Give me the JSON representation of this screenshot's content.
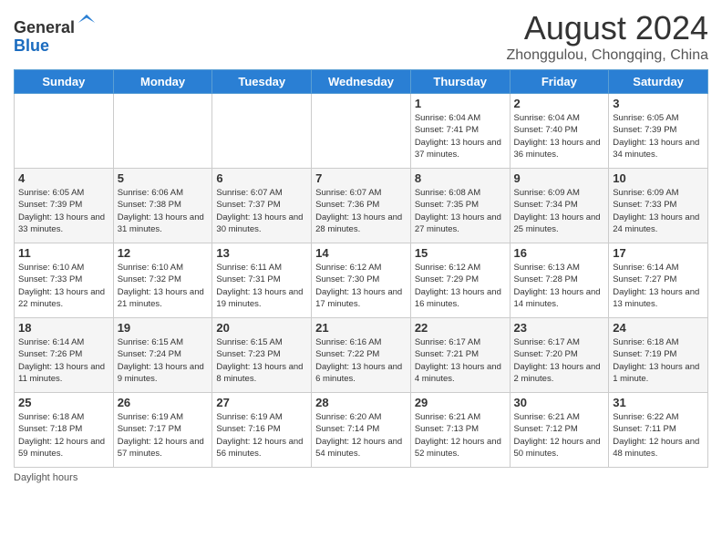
{
  "logo": {
    "general": "General",
    "blue": "Blue"
  },
  "title": "August 2024",
  "location": "Zhonggulou, Chongqing, China",
  "days_header": [
    "Sunday",
    "Monday",
    "Tuesday",
    "Wednesday",
    "Thursday",
    "Friday",
    "Saturday"
  ],
  "weeks": [
    [
      {
        "day": "",
        "info": ""
      },
      {
        "day": "",
        "info": ""
      },
      {
        "day": "",
        "info": ""
      },
      {
        "day": "",
        "info": ""
      },
      {
        "day": "1",
        "info": "Sunrise: 6:04 AM\nSunset: 7:41 PM\nDaylight: 13 hours\nand 37 minutes."
      },
      {
        "day": "2",
        "info": "Sunrise: 6:04 AM\nSunset: 7:40 PM\nDaylight: 13 hours\nand 36 minutes."
      },
      {
        "day": "3",
        "info": "Sunrise: 6:05 AM\nSunset: 7:39 PM\nDaylight: 13 hours\nand 34 minutes."
      }
    ],
    [
      {
        "day": "4",
        "info": "Sunrise: 6:05 AM\nSunset: 7:39 PM\nDaylight: 13 hours\nand 33 minutes."
      },
      {
        "day": "5",
        "info": "Sunrise: 6:06 AM\nSunset: 7:38 PM\nDaylight: 13 hours\nand 31 minutes."
      },
      {
        "day": "6",
        "info": "Sunrise: 6:07 AM\nSunset: 7:37 PM\nDaylight: 13 hours\nand 30 minutes."
      },
      {
        "day": "7",
        "info": "Sunrise: 6:07 AM\nSunset: 7:36 PM\nDaylight: 13 hours\nand 28 minutes."
      },
      {
        "day": "8",
        "info": "Sunrise: 6:08 AM\nSunset: 7:35 PM\nDaylight: 13 hours\nand 27 minutes."
      },
      {
        "day": "9",
        "info": "Sunrise: 6:09 AM\nSunset: 7:34 PM\nDaylight: 13 hours\nand 25 minutes."
      },
      {
        "day": "10",
        "info": "Sunrise: 6:09 AM\nSunset: 7:33 PM\nDaylight: 13 hours\nand 24 minutes."
      }
    ],
    [
      {
        "day": "11",
        "info": "Sunrise: 6:10 AM\nSunset: 7:33 PM\nDaylight: 13 hours\nand 22 minutes."
      },
      {
        "day": "12",
        "info": "Sunrise: 6:10 AM\nSunset: 7:32 PM\nDaylight: 13 hours\nand 21 minutes."
      },
      {
        "day": "13",
        "info": "Sunrise: 6:11 AM\nSunset: 7:31 PM\nDaylight: 13 hours\nand 19 minutes."
      },
      {
        "day": "14",
        "info": "Sunrise: 6:12 AM\nSunset: 7:30 PM\nDaylight: 13 hours\nand 17 minutes."
      },
      {
        "day": "15",
        "info": "Sunrise: 6:12 AM\nSunset: 7:29 PM\nDaylight: 13 hours\nand 16 minutes."
      },
      {
        "day": "16",
        "info": "Sunrise: 6:13 AM\nSunset: 7:28 PM\nDaylight: 13 hours\nand 14 minutes."
      },
      {
        "day": "17",
        "info": "Sunrise: 6:14 AM\nSunset: 7:27 PM\nDaylight: 13 hours\nand 13 minutes."
      }
    ],
    [
      {
        "day": "18",
        "info": "Sunrise: 6:14 AM\nSunset: 7:26 PM\nDaylight: 13 hours\nand 11 minutes."
      },
      {
        "day": "19",
        "info": "Sunrise: 6:15 AM\nSunset: 7:24 PM\nDaylight: 13 hours\nand 9 minutes."
      },
      {
        "day": "20",
        "info": "Sunrise: 6:15 AM\nSunset: 7:23 PM\nDaylight: 13 hours\nand 8 minutes."
      },
      {
        "day": "21",
        "info": "Sunrise: 6:16 AM\nSunset: 7:22 PM\nDaylight: 13 hours\nand 6 minutes."
      },
      {
        "day": "22",
        "info": "Sunrise: 6:17 AM\nSunset: 7:21 PM\nDaylight: 13 hours\nand 4 minutes."
      },
      {
        "day": "23",
        "info": "Sunrise: 6:17 AM\nSunset: 7:20 PM\nDaylight: 13 hours\nand 2 minutes."
      },
      {
        "day": "24",
        "info": "Sunrise: 6:18 AM\nSunset: 7:19 PM\nDaylight: 13 hours\nand 1 minute."
      }
    ],
    [
      {
        "day": "25",
        "info": "Sunrise: 6:18 AM\nSunset: 7:18 PM\nDaylight: 12 hours\nand 59 minutes."
      },
      {
        "day": "26",
        "info": "Sunrise: 6:19 AM\nSunset: 7:17 PM\nDaylight: 12 hours\nand 57 minutes."
      },
      {
        "day": "27",
        "info": "Sunrise: 6:19 AM\nSunset: 7:16 PM\nDaylight: 12 hours\nand 56 minutes."
      },
      {
        "day": "28",
        "info": "Sunrise: 6:20 AM\nSunset: 7:14 PM\nDaylight: 12 hours\nand 54 minutes."
      },
      {
        "day": "29",
        "info": "Sunrise: 6:21 AM\nSunset: 7:13 PM\nDaylight: 12 hours\nand 52 minutes."
      },
      {
        "day": "30",
        "info": "Sunrise: 6:21 AM\nSunset: 7:12 PM\nDaylight: 12 hours\nand 50 minutes."
      },
      {
        "day": "31",
        "info": "Sunrise: 6:22 AM\nSunset: 7:11 PM\nDaylight: 12 hours\nand 48 minutes."
      }
    ]
  ],
  "footer": {
    "daylight_label": "Daylight hours"
  }
}
